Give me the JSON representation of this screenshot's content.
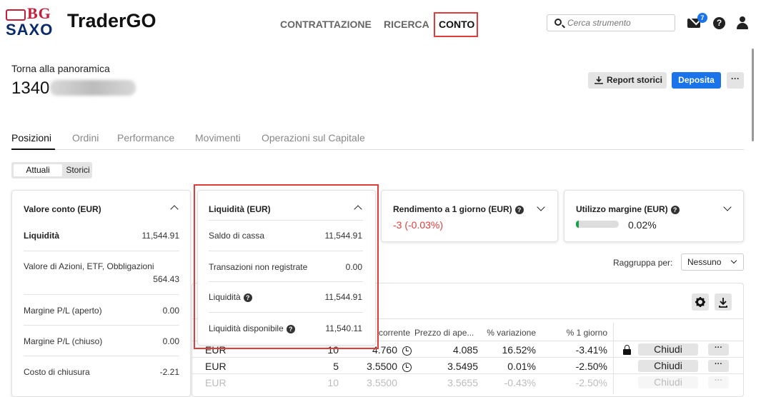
{
  "header": {
    "logo_bg": "BG",
    "logo_saxo": "SAXO",
    "app_name": "TraderGO",
    "nav": [
      "CONTRATTAZIONE",
      "RICERCA",
      "CONTO"
    ],
    "search_placeholder": "Cerca strumento",
    "mail_badge": "7",
    "help_icon": "?"
  },
  "account": {
    "back_link": "Torna alla panoramica",
    "number_prefix": "1340",
    "buttons": {
      "report": "Report storici",
      "deposit": "Deposita",
      "more": "···"
    }
  },
  "tabs": [
    "Posizioni",
    "Ordini",
    "Performance",
    "Movimenti",
    "Operazioni sul Capitale"
  ],
  "segment": {
    "on": "Attuali",
    "off": "Storici"
  },
  "valore_conto": {
    "title": "Valore conto (EUR)",
    "rows": [
      {
        "label": "Liquidità",
        "value": "11,544.91"
      },
      {
        "label": "Valore di Azioni, ETF, Obbligazioni",
        "value": "564.43"
      },
      {
        "label": "Margine P/L (aperto)",
        "value": "0.00"
      },
      {
        "label": "Margine P/L (chiuso)",
        "value": "0.00"
      },
      {
        "label": "Costo di chiusura",
        "value": "-2.21"
      }
    ]
  },
  "liquidita": {
    "title": "Liquidità (EUR)",
    "rows": [
      {
        "label": "Saldo di cassa",
        "value": "11,544.91"
      },
      {
        "label": "Transazioni non registrate",
        "value": "0.00"
      },
      {
        "label": "Liquidità",
        "value": "11,544.91"
      },
      {
        "label": "Liquidità disponibile",
        "value": "11,540.11"
      }
    ]
  },
  "rendimento": {
    "title": "Rendimento a 1 giorno (EUR)",
    "value": "-3 (-0.03%)"
  },
  "margine": {
    "title": "Utilizzo margine (EUR)",
    "value": "0.02%",
    "fill_fraction": 0.02
  },
  "group_by": {
    "label": "Raggruppa per:",
    "value": "Nessuno"
  },
  "table": {
    "headers": [
      "corrente",
      "Prezzo di ape...",
      "% variazione",
      "% 1 giorno"
    ],
    "rows": [
      {
        "currency": "EUR",
        "qty": "10",
        "price": "4.760",
        "open": "4.085",
        "change": "16.52%",
        "day": "-3.41%",
        "close": "Chiudi",
        "locked": true
      },
      {
        "currency": "EUR",
        "qty": "5",
        "price": "3.5500",
        "open": "3.5495",
        "change": "0.01%",
        "day": "-2.50%",
        "close": "Chiudi",
        "locked": false
      },
      {
        "currency": "EUR",
        "qty": "10",
        "price": "3.5500",
        "open": "3.5655",
        "change": "-0.43%",
        "day": "-2.50%",
        "close": "Chiudi",
        "locked": false
      }
    ]
  },
  "colors": {
    "accent": "#1a73e8",
    "negative": "#e03c3c",
    "positive": "#1aa04a",
    "highlight_box": "#e03c3c"
  }
}
